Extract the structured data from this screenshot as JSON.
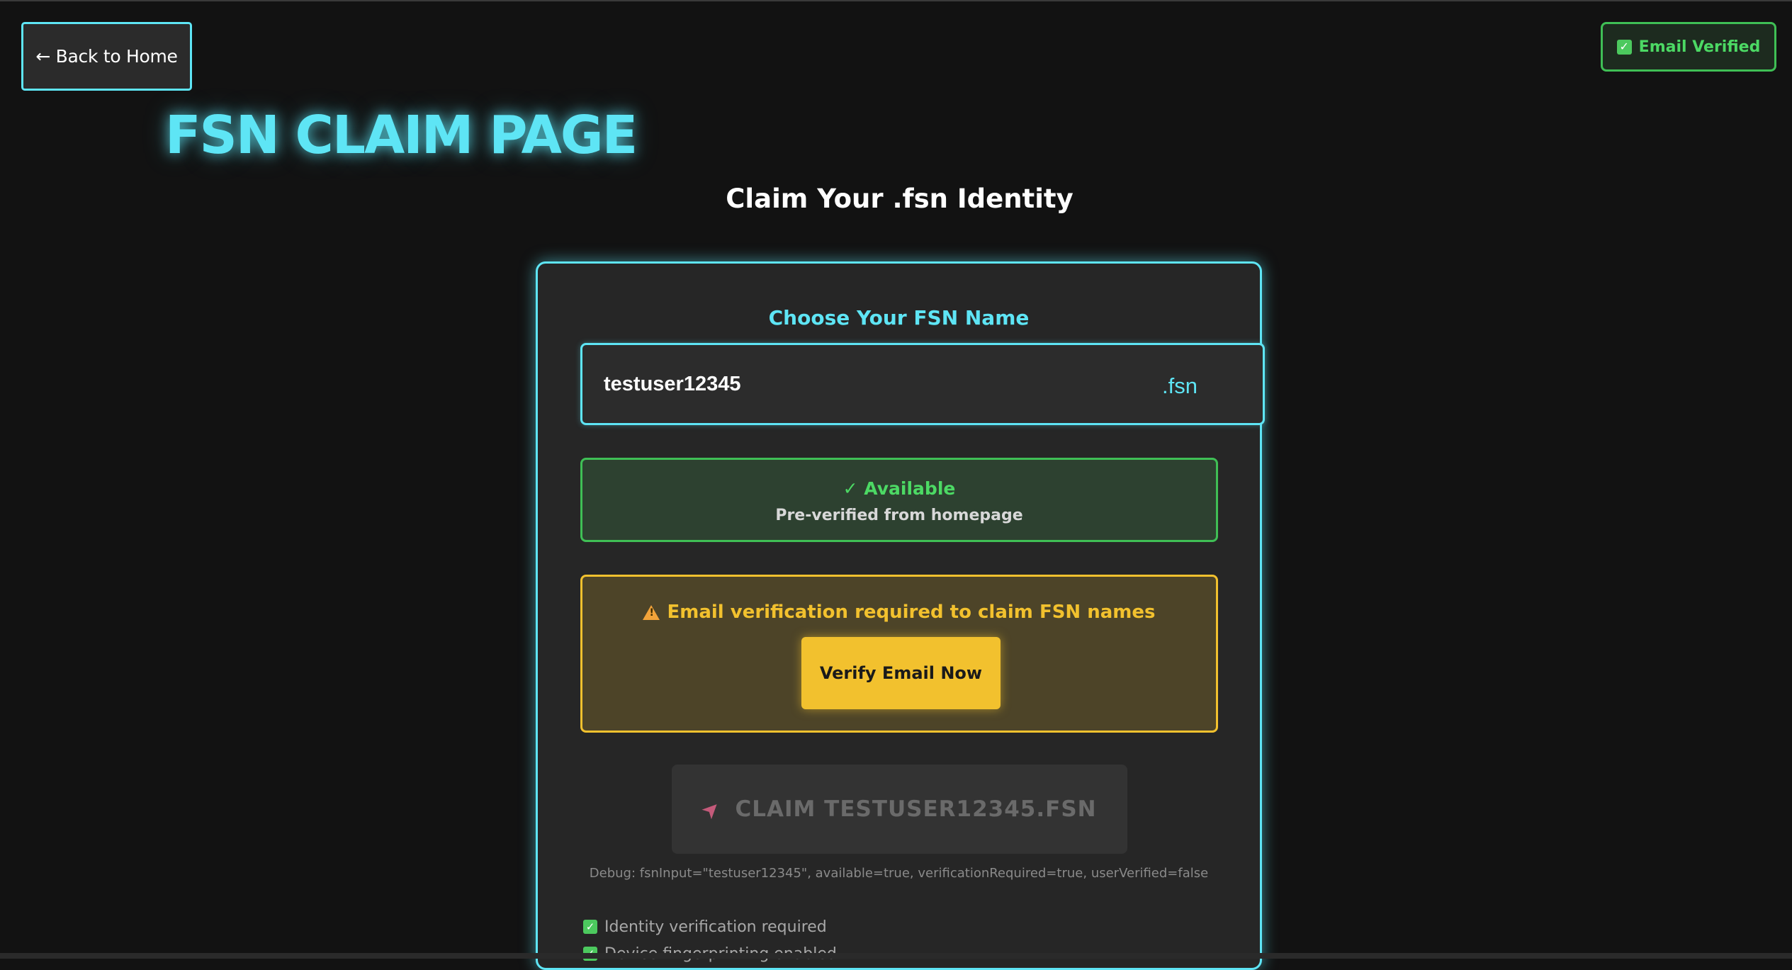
{
  "nav": {
    "back_label": "← Back to Home"
  },
  "email_badge": {
    "label": "Email Verified",
    "icon": "check-box-icon"
  },
  "page": {
    "heading": "FSN CLAIM PAGE",
    "subtitle": "Claim Your .fsn Identity"
  },
  "claim_form": {
    "heading": "Choose Your FSN Name",
    "input_value": "testuser12345",
    "suffix": ".fsn",
    "availability": {
      "status": "✓ Available",
      "note": "Pre-verified from homepage"
    },
    "warning": {
      "icon": "warning-icon",
      "text": "Email verification required to claim FSN names",
      "button_label": "Verify Email Now"
    },
    "claim_button": {
      "icon": "rocket-icon",
      "label": "CLAIM TESTUSER12345.FSN"
    },
    "debug": "Debug: fsnInput=\"testuser12345\", available=true, verificationRequired=true, userVerified=false",
    "checklist": [
      {
        "label": "Identity verification required"
      },
      {
        "label": "Device fingerprinting enabled"
      }
    ]
  },
  "colors": {
    "accent_cyan": "#5ee5f5",
    "success_green": "#4cd964",
    "warning_yellow": "#f2c12e",
    "background": "#121212"
  }
}
